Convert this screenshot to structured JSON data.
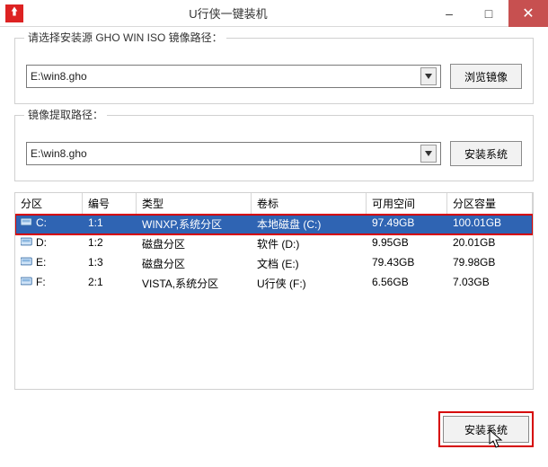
{
  "window": {
    "title": "U行侠一键装机"
  },
  "groups": {
    "source": {
      "label": "请选择安装源 GHO WIN ISO 镜像路径：",
      "value": "E:\\win8.gho",
      "browse": "浏览镜像"
    },
    "extract": {
      "label": "镜像提取路径：",
      "value": "E:\\win8.gho",
      "install": "安装系统"
    }
  },
  "table": {
    "headers": {
      "part": "分区",
      "num": "编号",
      "type": "类型",
      "label": "卷标",
      "free": "可用空间",
      "cap": "分区容量"
    },
    "rows": [
      {
        "part": "C:",
        "num": "1:1",
        "type": "WINXP,系统分区",
        "label": "本地磁盘 (C:)",
        "free": "97.49GB",
        "cap": "100.01GB",
        "selected": true
      },
      {
        "part": "D:",
        "num": "1:2",
        "type": "磁盘分区",
        "label": "软件 (D:)",
        "free": "9.95GB",
        "cap": "20.01GB"
      },
      {
        "part": "E:",
        "num": "1:3",
        "type": "磁盘分区",
        "label": "文档 (E:)",
        "free": "79.43GB",
        "cap": "79.98GB"
      },
      {
        "part": "F:",
        "num": "2:1",
        "type": "VISTA,系统分区",
        "label": "U行侠 (F:)",
        "free": "6.56GB",
        "cap": "7.03GB"
      }
    ]
  },
  "footer": {
    "install": "安装系统"
  }
}
